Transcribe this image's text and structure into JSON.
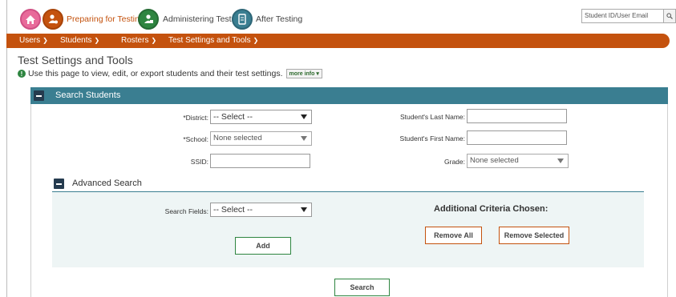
{
  "nav": {
    "preparing": "Preparing for Testing",
    "administering": "Administering Tests",
    "after": "After Testing",
    "search_placeholder": "Student ID/User Email"
  },
  "menu": {
    "users": "Users",
    "students": "Students",
    "rosters": "Rosters",
    "settings": "Test Settings and Tools"
  },
  "page": {
    "title": "Test Settings and Tools",
    "info": "Use this page to view, edit, or export students and their test settings.",
    "more_info": "more info"
  },
  "search_panel": {
    "title": "Search Students",
    "district_label": "*District:",
    "district_value": "-- Select --",
    "school_label": "*School:",
    "school_value": "None selected",
    "ssid_label": "SSID:",
    "last_name_label": "Student's Last Name:",
    "first_name_label": "Student's First Name:",
    "grade_label": "Grade:",
    "grade_value": "None selected"
  },
  "advanced": {
    "title": "Advanced Search",
    "fields_label": "Search Fields:",
    "fields_value": "-- Select --",
    "criteria_title": "Additional Criteria Chosen:",
    "add": "Add",
    "remove_all": "Remove All",
    "remove_selected": "Remove Selected"
  },
  "search_button": "Search",
  "colors": {
    "orange": "#c4520e",
    "teal": "#3a7e91",
    "green": "#2e8540",
    "pink": "#e86a9a"
  }
}
